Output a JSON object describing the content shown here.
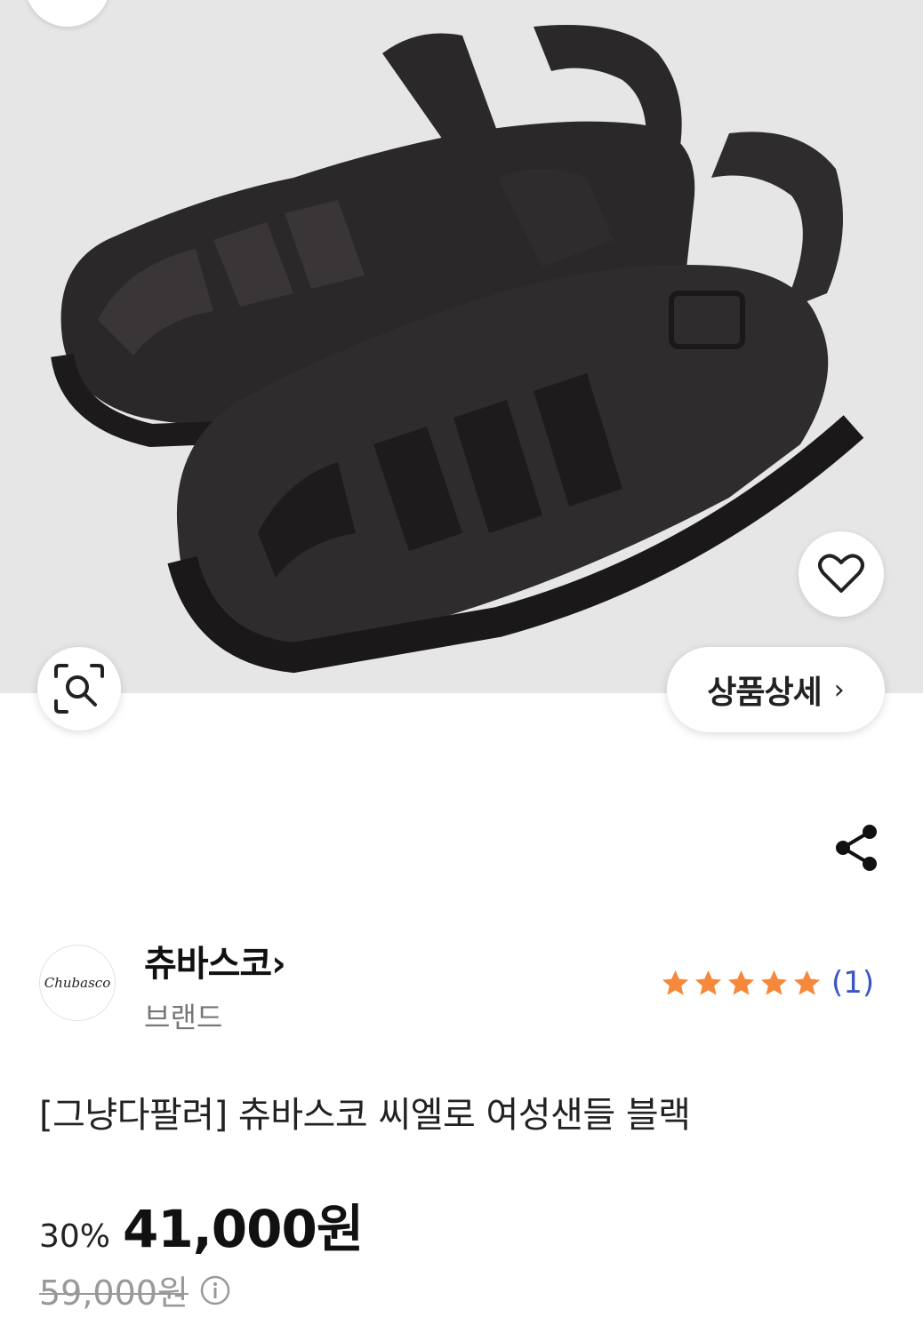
{
  "hero": {
    "detail_button_label": "상품상세",
    "detail_chevron": "›"
  },
  "brand": {
    "logo_text": "Chubasco",
    "name": "츄바스코›",
    "type": "브랜드"
  },
  "rating": {
    "stars": 5,
    "count_text": "(1)",
    "star_color": "#f5883a",
    "count_color": "#3a55c8"
  },
  "product": {
    "title": "[그냥다팔려] 츄바스코 씨엘로 여성샌들 블랙",
    "discount": "30%",
    "price": "41,000원",
    "original_price": "59,000원"
  },
  "icons": [
    "back-icon",
    "heart-icon",
    "lens-search-icon",
    "chevron-right-icon",
    "share-icon",
    "star-icon",
    "info-icon"
  ]
}
